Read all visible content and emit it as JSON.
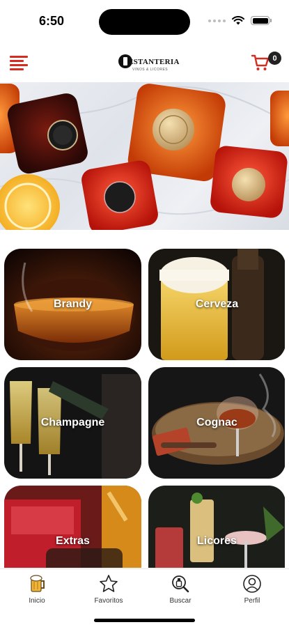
{
  "status_bar": {
    "time": "6:50",
    "icons": [
      "cellular-icon",
      "wifi-icon",
      "battery-icon"
    ]
  },
  "header": {
    "menu_icon": "hamburger-menu-icon",
    "logo_title": "ESTANTERIA",
    "logo_subtitle": "VINOS & LICORES",
    "cart_icon": "cart-icon",
    "cart_count": "0",
    "accent_color": "#d62b20"
  },
  "categories": [
    {
      "label": "Brandy"
    },
    {
      "label": "Cerveza"
    },
    {
      "label": "Champagne"
    },
    {
      "label": "Cognac"
    },
    {
      "label": "Extras"
    },
    {
      "label": "Licores"
    }
  ],
  "tabbar": {
    "tabs": [
      {
        "label": "Inicio",
        "icon": "beer-mug-icon"
      },
      {
        "label": "Favoritos",
        "icon": "star-icon"
      },
      {
        "label": "Buscar",
        "icon": "search-bottle-icon"
      },
      {
        "label": "Perfil",
        "icon": "user-icon"
      }
    ]
  }
}
